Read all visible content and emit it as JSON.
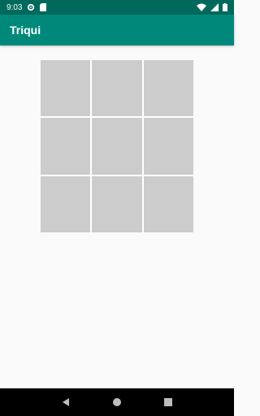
{
  "status_bar": {
    "time": "9:03",
    "icons": [
      "gear-icon",
      "sd-card-icon",
      "wifi-icon",
      "signal-icon",
      "battery-icon"
    ]
  },
  "app_bar": {
    "title": "Triqui"
  },
  "board": {
    "rows": 3,
    "cols": 3,
    "cells": [
      "",
      "",
      "",
      "",
      "",
      "",
      "",
      "",
      ""
    ]
  },
  "nav_bar": {
    "icons": [
      "back-icon",
      "home-icon",
      "recents-icon"
    ]
  },
  "colors": {
    "status_bar": "#00695c",
    "app_bar": "#00897b",
    "cell": "#cccccc",
    "background": "#fafafa"
  }
}
